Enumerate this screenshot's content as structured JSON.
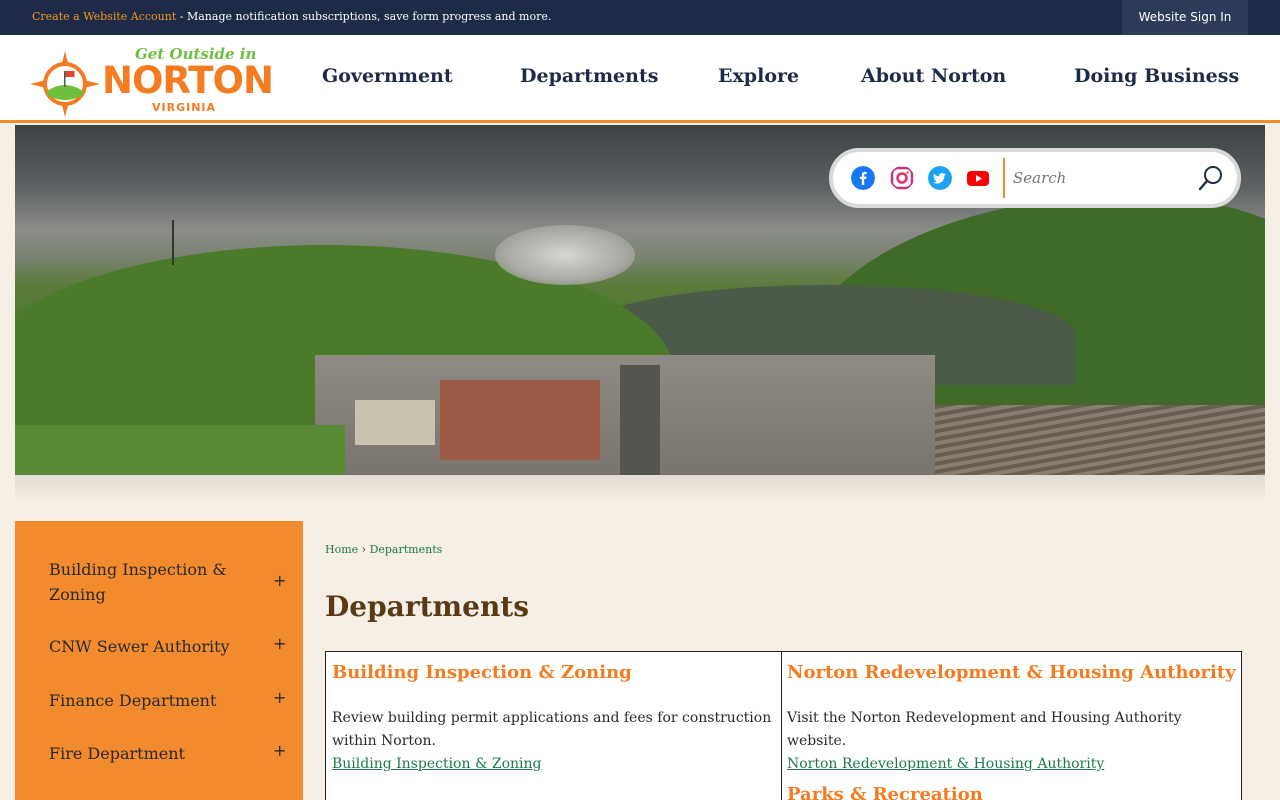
{
  "topbar": {
    "create_account_link": "Create a Website Account",
    "message": " - Manage notification subscriptions, save form progress and more.",
    "sign_in_label": "Website Sign In"
  },
  "logo": {
    "tagline": "Get Outside in",
    "name": "NORTON",
    "state": "VIRGINIA"
  },
  "nav": {
    "items": [
      "Government",
      "Departments",
      "Explore",
      "About Norton",
      "Doing Business"
    ]
  },
  "social": {
    "icons": [
      "facebook-icon",
      "instagram-icon",
      "twitter-icon",
      "youtube-icon"
    ],
    "colors": {
      "facebook": "#1877f2",
      "instagram": "#c13584",
      "twitter": "#1da1f2",
      "youtube": "#ff0000"
    }
  },
  "search": {
    "placeholder": "Search"
  },
  "sidebar": {
    "items": [
      {
        "label": "Building Inspection & Zoning",
        "toggle": "+"
      },
      {
        "label": "CNW Sewer Authority",
        "toggle": "+"
      },
      {
        "label": "Finance Department",
        "toggle": "+"
      },
      {
        "label": "Fire Department",
        "toggle": "+"
      }
    ]
  },
  "breadcrumb": {
    "home": "Home",
    "separator": "›",
    "current": "Departments"
  },
  "main": {
    "title": "Departments",
    "departments": [
      {
        "title": "Building Inspection & Zoning",
        "description": "Review building permit applications and fees for construction within Norton.",
        "link": "Building Inspection & Zoning"
      },
      {
        "title": "Norton Redevelopment & Housing Authority",
        "description": "Visit the Norton Redevelopment and Housing Authority website.",
        "link": "Norton Redevelopment & Housing Authority"
      },
      {
        "title": "Parks & Recreation"
      }
    ]
  },
  "colors": {
    "navy": "#1d2a48",
    "orange": "#f28a2e",
    "heading_orange": "#f47b20",
    "link_green": "#1e7a4a",
    "title_brown": "#5a3a12"
  }
}
